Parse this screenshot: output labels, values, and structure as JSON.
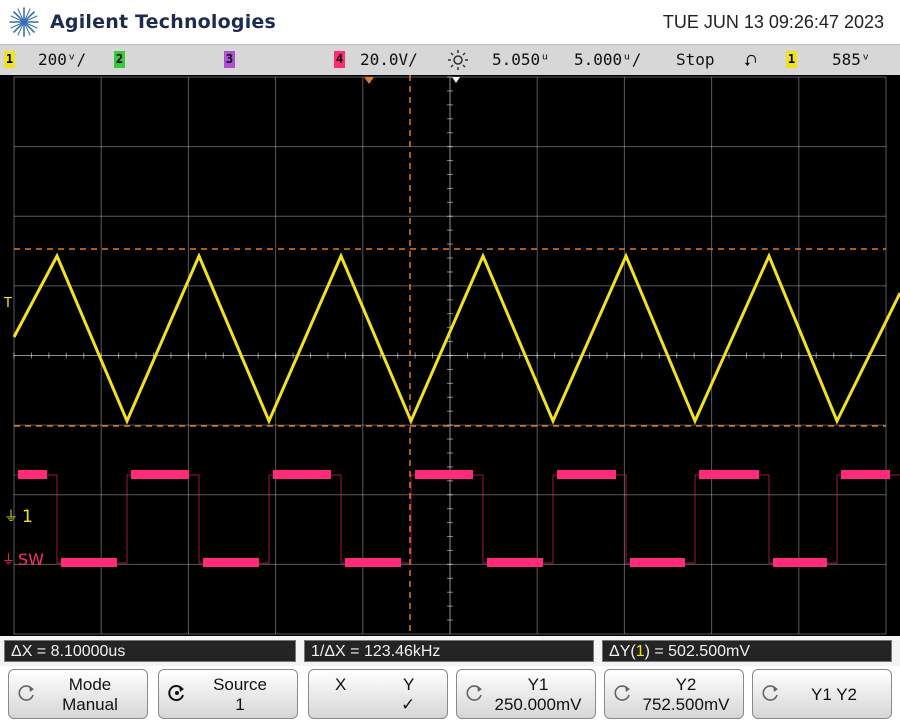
{
  "header": {
    "brand": "Agilent Technologies",
    "datetime": "TUE JUN 13 09:26:47 2023"
  },
  "status": {
    "ch1_label": "1",
    "ch1_scale": "200ᵛ/",
    "ch2_label": "2",
    "ch3_label": "3",
    "ch4_label": "4",
    "ch4_scale": "20.0V/",
    "time_delay": "5.050ᵘ",
    "time_scale": "5.000ᵘ/",
    "run_state": "Stop",
    "trigger_slope_symbol": "⮏",
    "trigger_source": "1",
    "trigger_level": "585ᵛ"
  },
  "screen": {
    "ch1_marker": "1",
    "ch4_marker": "SW",
    "trigger_marker": "T"
  },
  "measurements": {
    "dx": "ΔX = 8.10000us",
    "inv_dx": "1/ΔX = 123.46kHz",
    "dy_prefix": "ΔY(",
    "dy_channel": "1",
    "dy_suffix": ") = 502.500mV"
  },
  "softkeys": {
    "mode_title": "Mode",
    "mode_value": "Manual",
    "source_title": "Source",
    "source_value": "1",
    "x_label": "X",
    "y_label": "Y",
    "check_mark": "✓",
    "y1_title": "Y1",
    "y1_value": "250.000mV",
    "y2_title": "Y2",
    "y2_value": "752.500mV",
    "y1y2_label": "Y1 Y2"
  },
  "colors": {
    "ch1": "#f0e21f",
    "ch4": "#ff2a7a",
    "cursor": "#e07a2b",
    "grid": "#ffffff",
    "screen_bg": "#000000"
  }
}
